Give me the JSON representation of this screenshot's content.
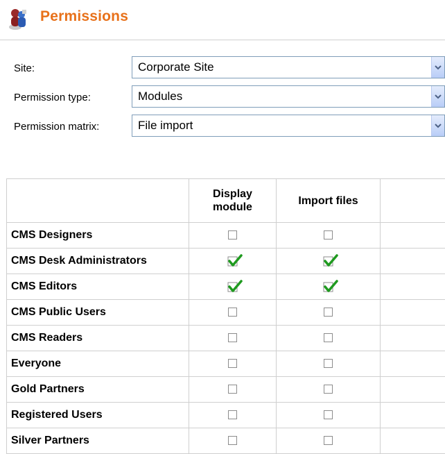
{
  "header": {
    "title": "Permissions",
    "icon": "users-permissions-icon",
    "accent_color": "#e8711a"
  },
  "form": {
    "site": {
      "label": "Site:",
      "value": "Corporate Site"
    },
    "permission_type": {
      "label": "Permission type:",
      "value": "Modules"
    },
    "permission_matrix": {
      "label": "Permission matrix:",
      "value": "File import"
    }
  },
  "matrix": {
    "columns": [
      "",
      "Display module",
      "Import files",
      ""
    ],
    "rows": [
      {
        "name": "CMS Designers",
        "display_module": false,
        "import_files": false
      },
      {
        "name": "CMS Desk Administrators",
        "display_module": true,
        "import_files": true
      },
      {
        "name": "CMS Editors",
        "display_module": true,
        "import_files": true
      },
      {
        "name": "CMS Public Users",
        "display_module": false,
        "import_files": false
      },
      {
        "name": "CMS Readers",
        "display_module": false,
        "import_files": false
      },
      {
        "name": "Everyone",
        "display_module": false,
        "import_files": false
      },
      {
        "name": "Gold Partners",
        "display_module": false,
        "import_files": false
      },
      {
        "name": "Registered Users",
        "display_module": false,
        "import_files": false
      },
      {
        "name": "Silver Partners",
        "display_module": false,
        "import_files": false
      }
    ]
  },
  "colors": {
    "check_green": "#1f9a1f",
    "select_border": "#7f9db9"
  }
}
